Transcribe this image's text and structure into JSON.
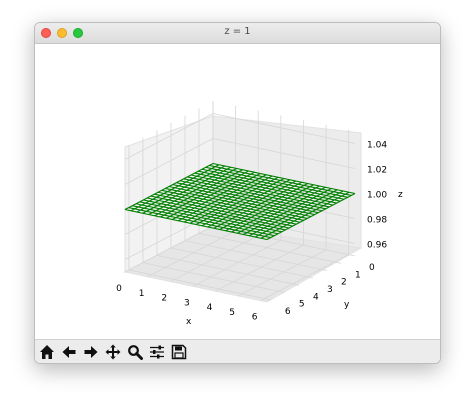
{
  "window": {
    "title": "z = 1"
  },
  "toolbar": {
    "buttons": [
      {
        "icon": "home-icon"
      },
      {
        "icon": "back-arrow-icon"
      },
      {
        "icon": "forward-arrow-icon"
      },
      {
        "icon": "pan-icon"
      },
      {
        "icon": "zoom-icon"
      },
      {
        "icon": "configure-subplots-icon"
      },
      {
        "icon": "save-icon"
      }
    ]
  },
  "chart_data": {
    "type": "wireframe",
    "title": "",
    "xlabel": "x",
    "ylabel": "y",
    "zlabel": "z",
    "x_ticks": [
      "0",
      "1",
      "2",
      "3",
      "4",
      "5",
      "6"
    ],
    "y_ticks": [
      "0",
      "1",
      "2",
      "3",
      "4",
      "5",
      "6"
    ],
    "z_ticks": [
      "0.96",
      "0.98",
      "1.00",
      "1.02",
      "1.04"
    ],
    "xlim": [
      0,
      6.28
    ],
    "ylim": [
      0,
      6.28
    ],
    "zlim": [
      0.95,
      1.05
    ],
    "surface_z": 1.0,
    "grid_lines_per_axis": 25,
    "grid": true,
    "wire_color": "#008000"
  }
}
